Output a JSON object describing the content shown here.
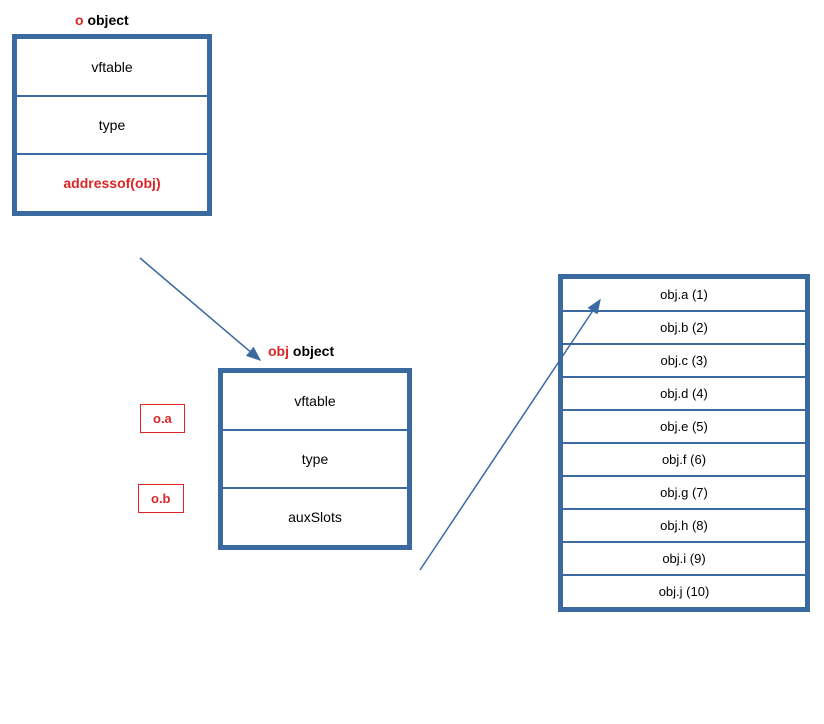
{
  "titles": {
    "o": {
      "red": "o",
      "rest": " object"
    },
    "obj": {
      "red": "obj",
      "rest": " object"
    }
  },
  "oTable": {
    "vftable": "vftable",
    "type": "type",
    "addrof": "addressof(obj)"
  },
  "objTable": {
    "vftable": "vftable",
    "type": "type",
    "auxSlots": "auxSlots"
  },
  "labels": {
    "oa": "o.a",
    "ob": "o.b"
  },
  "slots": [
    "obj.a (1)",
    "obj.b (2)",
    "obj.c (3)",
    "obj.d (4)",
    "obj.e (5)",
    "obj.f (6)",
    "obj.g (7)",
    "obj.h (8)",
    "obj.i (9)",
    "obj.j (10)"
  ]
}
